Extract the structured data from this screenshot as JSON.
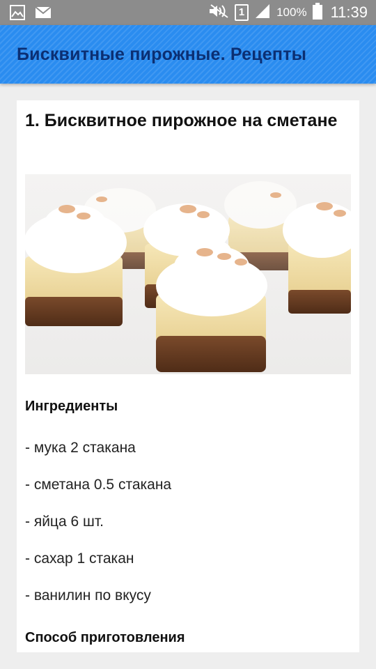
{
  "status_bar": {
    "battery_percent": "100%",
    "time": "11:39",
    "sim_slot": "1",
    "icons": [
      "gallery-icon",
      "mail-icon",
      "mute-icon",
      "sim-icon",
      "signal-icon",
      "battery-icon"
    ]
  },
  "app_bar": {
    "title": "Бисквитные пирожные. Рецепты",
    "color": "#2a8cf0",
    "title_color": "#0b2f73"
  },
  "recipe": {
    "title": "1. Бисквитное пирожное на сметане",
    "ingredients_heading": "Ингредиенты",
    "ingredients": [
      "- мука 2 стакана",
      "- сметана 0.5 стакана",
      "- яйца 6 шт.",
      "- сахар 1 стакан",
      "- ванилин по вкусу"
    ],
    "method_heading": "Способ приготовления"
  }
}
